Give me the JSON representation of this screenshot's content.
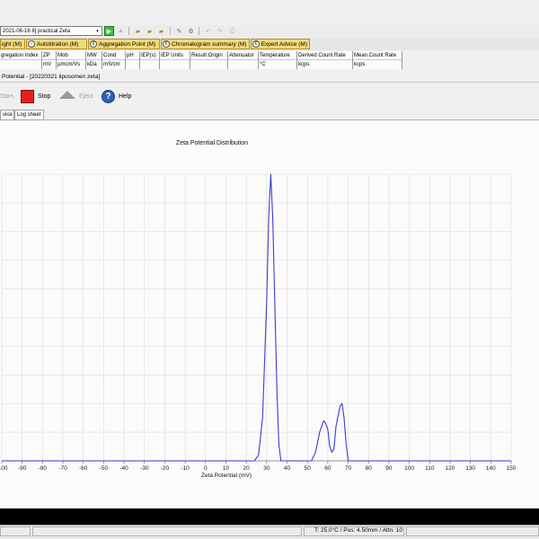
{
  "toolbar": {
    "file_name": "2021-06-16 8] practical Zeta",
    "icons": [
      "play-icon",
      "up-arrow-icon",
      "folder-open-icon",
      "folder-save-icon",
      "folder-icon",
      "measure-icon",
      "settings-icon",
      "undo-icon",
      "redo-icon",
      "print-icon"
    ]
  },
  "tabs": [
    {
      "label": "ight (M)"
    },
    {
      "label": "Autotitration (M)"
    },
    {
      "label": "Aggregation Point (M)"
    },
    {
      "label": "Chromatogram summary (M)"
    },
    {
      "label": "Expert Advice (M)"
    }
  ],
  "columns": [
    {
      "header": "gregation Index",
      "unit": ""
    },
    {
      "header": "ZP",
      "unit": "mV"
    },
    {
      "header": "Mob",
      "unit": "µmcm/Vs"
    },
    {
      "header": "MW",
      "unit": "kDa"
    },
    {
      "header": "Cond",
      "unit": "mS/cm"
    },
    {
      "header": "pH",
      "unit": ""
    },
    {
      "header": "IEP(s)",
      "unit": ""
    },
    {
      "header": "IEP Units",
      "unit": ""
    },
    {
      "header": "Result Origin",
      "unit": ""
    },
    {
      "header": "Attenuator",
      "unit": ""
    },
    {
      "header": "Temperature",
      "unit": "°C"
    },
    {
      "header": "Derived Count Rate",
      "unit": "kcps"
    },
    {
      "header": "Mean Count Rate",
      "unit": "kcps"
    }
  ],
  "document": {
    "title": "Potential - [20220321 liposomen zeta]"
  },
  "commands": {
    "start_label": "Sta",
    "stop_label": "Stop",
    "eject_label": "Eject",
    "help_label": "Help"
  },
  "subtabs": [
    {
      "label": "vice"
    },
    {
      "label": "Log sheet"
    }
  ],
  "status": {
    "text": "T: 25.0°C / Pos: 4.50mm / Attn: 10"
  },
  "chart_data": {
    "type": "line",
    "title": "Zeta Potential Distribution",
    "xlabel": "Zeta Potential (mV)",
    "ylabel": "",
    "xlim": [
      -100,
      150
    ],
    "x_ticks": [
      -100,
      -90,
      -80,
      -70,
      -60,
      -50,
      -40,
      -30,
      -20,
      -10,
      0,
      10,
      20,
      30,
      40,
      50,
      60,
      70,
      80,
      90,
      100,
      110,
      120,
      130,
      140,
      150
    ],
    "x_tick_labels": [
      "-100",
      "-90",
      "-80",
      "-70",
      "-60",
      "-50",
      "-40",
      "-30",
      "-20",
      "-10",
      "0",
      "10",
      "20",
      "30",
      "40",
      "50",
      "60",
      "70",
      "80",
      "90",
      "100",
      "110",
      "120",
      "130",
      "140",
      "150"
    ],
    "ylim": [
      0,
      1
    ],
    "grid": true,
    "color": "#3b3bd4",
    "series": [
      {
        "points": [
          [
            -100,
            0
          ],
          [
            24,
            0
          ],
          [
            26,
            0.02
          ],
          [
            28,
            0.15
          ],
          [
            30,
            0.55
          ],
          [
            31,
            0.85
          ],
          [
            32,
            1.0
          ],
          [
            33,
            0.85
          ],
          [
            34,
            0.55
          ],
          [
            35,
            0.25
          ],
          [
            36,
            0.06
          ],
          [
            37,
            0
          ],
          [
            52,
            0
          ],
          [
            54,
            0.03
          ],
          [
            56,
            0.1
          ],
          [
            57,
            0.12
          ],
          [
            58,
            0.14
          ],
          [
            59,
            0.13
          ],
          [
            60,
            0.11
          ],
          [
            61,
            0.05
          ],
          [
            62,
            0.03
          ],
          [
            63,
            0.04
          ],
          [
            64,
            0.12
          ],
          [
            66,
            0.19
          ],
          [
            67,
            0.2
          ],
          [
            68,
            0.15
          ],
          [
            69,
            0.06
          ],
          [
            70,
            0
          ],
          [
            150,
            0
          ]
        ]
      }
    ]
  }
}
